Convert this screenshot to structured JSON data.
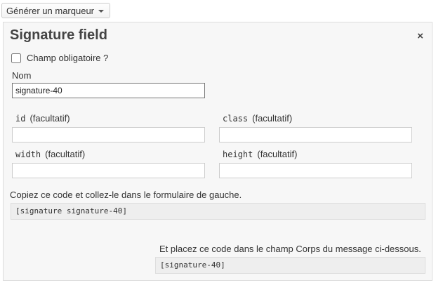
{
  "generator": {
    "label": "Générer un marqueur"
  },
  "panel": {
    "title": "Signature field",
    "close_symbol": "×",
    "required": {
      "label": "Champ obligatoire ?",
      "checked": false
    },
    "name": {
      "label": "Nom",
      "value": "signature-40"
    },
    "id_field": {
      "code": "id",
      "note": "(facultatif)",
      "value": ""
    },
    "class_field": {
      "code": "class",
      "note": "(facultatif)",
      "value": ""
    },
    "width_field": {
      "code": "width",
      "note": "(facultatif)",
      "value": ""
    },
    "height_field": {
      "code": "height",
      "note": "(facultatif)",
      "value": ""
    },
    "copy_instruction": "Copiez ce code et collez-le dans le formulaire de gauche.",
    "form_tag": "[signature signature-40]",
    "mail_instruction": "Et placez ce code dans le champ Corps du message ci-dessous.",
    "mail_tag": "[signature-40]"
  }
}
